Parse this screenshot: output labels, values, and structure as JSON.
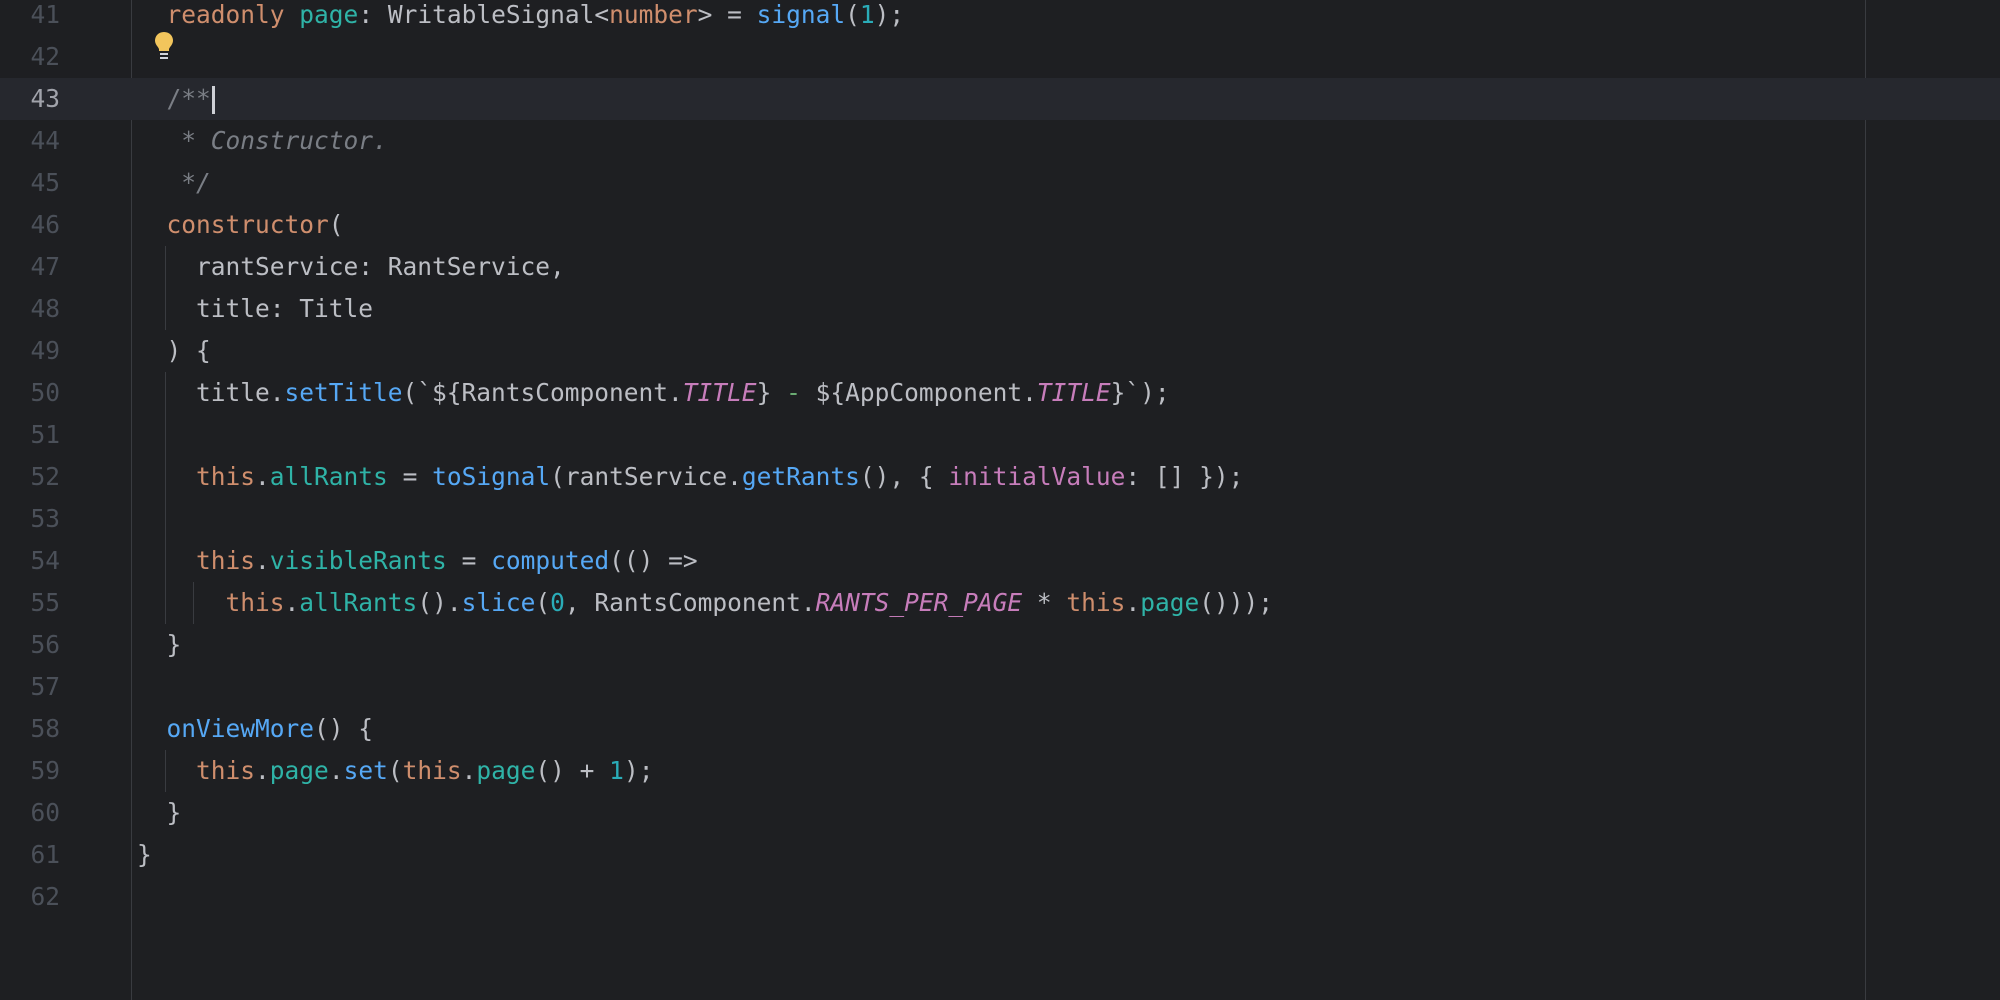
{
  "editor": {
    "current_line": "43",
    "lines": [
      {
        "n": "41",
        "parts": [
          {
            "t": "  "
          },
          {
            "t": "readonly",
            "c": "kw"
          },
          {
            "t": " "
          },
          {
            "t": "page",
            "c": "prop"
          },
          {
            "t": ": WritableSignal<"
          },
          {
            "t": "number",
            "c": "kw"
          },
          {
            "t": "> = "
          },
          {
            "t": "signal",
            "c": "fn"
          },
          {
            "t": "("
          },
          {
            "t": "1",
            "c": "num"
          },
          {
            "t": ");"
          }
        ]
      },
      {
        "n": "42",
        "parts": []
      },
      {
        "n": "43",
        "parts": [
          {
            "t": "  "
          },
          {
            "t": "/**",
            "c": "cmtp"
          }
        ]
      },
      {
        "n": "44",
        "parts": [
          {
            "t": "   * Constructor.",
            "c": "cmt"
          }
        ]
      },
      {
        "n": "45",
        "parts": [
          {
            "t": "   */",
            "c": "cmt"
          }
        ]
      },
      {
        "n": "46",
        "parts": [
          {
            "t": "  "
          },
          {
            "t": "constructor",
            "c": "kw"
          },
          {
            "t": "("
          }
        ]
      },
      {
        "n": "47",
        "parts": [
          {
            "t": "    rantService: RantService,"
          }
        ]
      },
      {
        "n": "48",
        "parts": [
          {
            "t": "    title: Title"
          }
        ]
      },
      {
        "n": "49",
        "parts": [
          {
            "t": "  ) {"
          }
        ]
      },
      {
        "n": "50",
        "parts": [
          {
            "t": "    title."
          },
          {
            "t": "setTitle",
            "c": "fn"
          },
          {
            "t": "(`${RantsComponent."
          },
          {
            "t": "TITLE",
            "c": "konst"
          },
          {
            "t": "} "
          },
          {
            "t": "-",
            "c": "str"
          },
          {
            "t": " ${AppComponent."
          },
          {
            "t": "TITLE",
            "c": "konst"
          },
          {
            "t": "}`);"
          }
        ]
      },
      {
        "n": "51",
        "parts": []
      },
      {
        "n": "52",
        "parts": [
          {
            "t": "    "
          },
          {
            "t": "this",
            "c": "kw"
          },
          {
            "t": "."
          },
          {
            "t": "allRants",
            "c": "prop"
          },
          {
            "t": " = "
          },
          {
            "t": "toSignal",
            "c": "fn"
          },
          {
            "t": "(rantService."
          },
          {
            "t": "getRants",
            "c": "fn"
          },
          {
            "t": "(), { "
          },
          {
            "t": "initialValue",
            "c": "named"
          },
          {
            "t": ": [] });"
          }
        ]
      },
      {
        "n": "53",
        "parts": []
      },
      {
        "n": "54",
        "parts": [
          {
            "t": "    "
          },
          {
            "t": "this",
            "c": "kw"
          },
          {
            "t": "."
          },
          {
            "t": "visibleRants",
            "c": "prop"
          },
          {
            "t": " = "
          },
          {
            "t": "computed",
            "c": "fn"
          },
          {
            "t": "(() =>"
          }
        ]
      },
      {
        "n": "55",
        "parts": [
          {
            "t": "      "
          },
          {
            "t": "this",
            "c": "kw"
          },
          {
            "t": "."
          },
          {
            "t": "allRants",
            "c": "prop"
          },
          {
            "t": "()."
          },
          {
            "t": "slice",
            "c": "fn"
          },
          {
            "t": "("
          },
          {
            "t": "0",
            "c": "num"
          },
          {
            "t": ", RantsComponent."
          },
          {
            "t": "RANTS_PER_PAGE",
            "c": "konst"
          },
          {
            "t": " * "
          },
          {
            "t": "this",
            "c": "kw"
          },
          {
            "t": "."
          },
          {
            "t": "page",
            "c": "prop"
          },
          {
            "t": "()));"
          }
        ]
      },
      {
        "n": "56",
        "parts": [
          {
            "t": "  }"
          }
        ]
      },
      {
        "n": "57",
        "parts": []
      },
      {
        "n": "58",
        "parts": [
          {
            "t": "  "
          },
          {
            "t": "onViewMore",
            "c": "fn"
          },
          {
            "t": "() {"
          }
        ]
      },
      {
        "n": "59",
        "parts": [
          {
            "t": "    "
          },
          {
            "t": "this",
            "c": "kw"
          },
          {
            "t": "."
          },
          {
            "t": "page",
            "c": "prop"
          },
          {
            "t": "."
          },
          {
            "t": "set",
            "c": "fn"
          },
          {
            "t": "("
          },
          {
            "t": "this",
            "c": "kw"
          },
          {
            "t": "."
          },
          {
            "t": "page",
            "c": "prop"
          },
          {
            "t": "() + "
          },
          {
            "t": "1",
            "c": "num"
          },
          {
            "t": ");"
          }
        ]
      },
      {
        "n": "60",
        "parts": [
          {
            "t": "  }"
          }
        ]
      },
      {
        "n": "61",
        "parts": [
          {
            "t": "}"
          }
        ]
      },
      {
        "n": "62",
        "parts": []
      }
    ]
  },
  "intention_action": {
    "icon": "lightbulb-icon",
    "color": "#f2c55c"
  },
  "theme": {
    "background": "#1e1f22",
    "current_line": "#26282e"
  }
}
